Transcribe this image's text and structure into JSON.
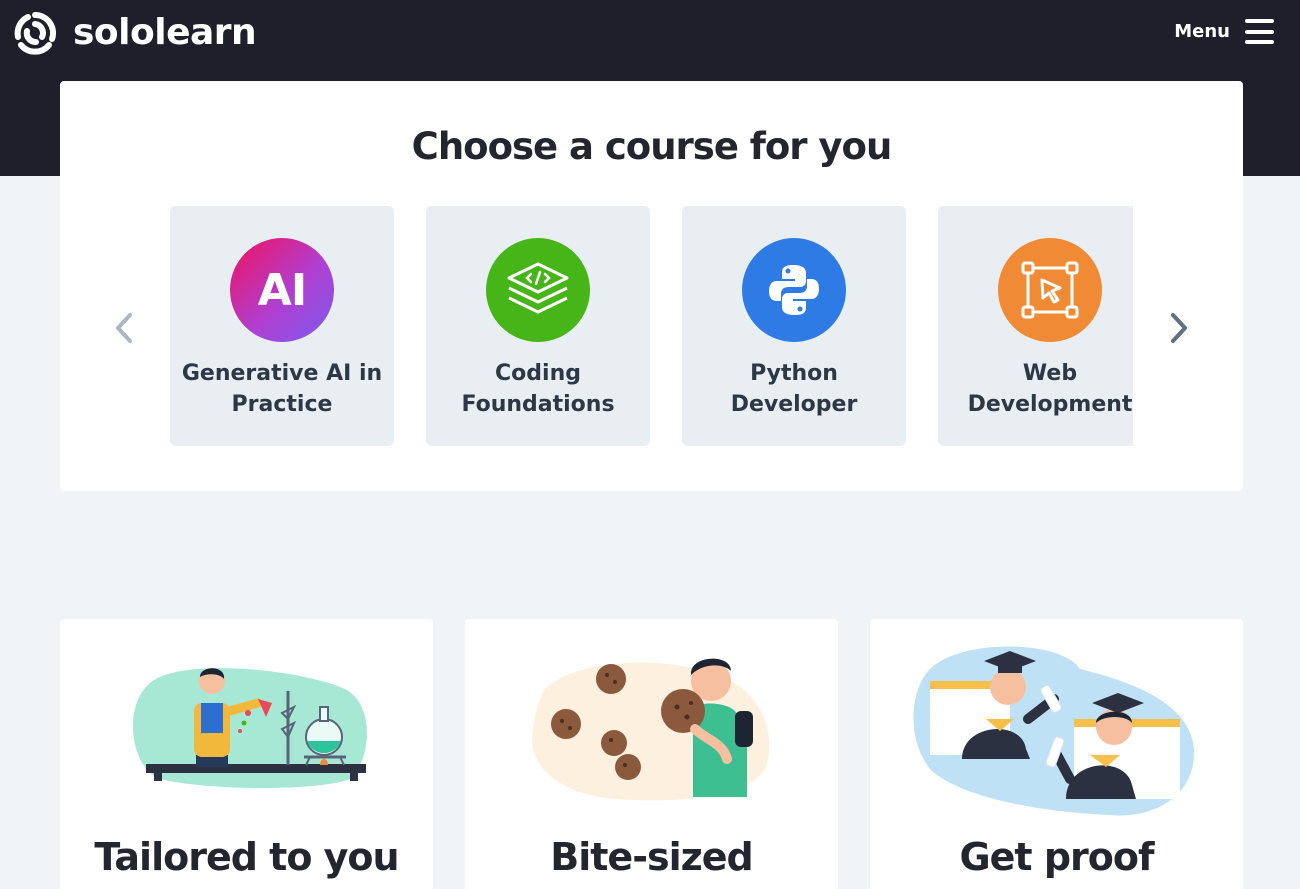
{
  "brand": {
    "name": "sololearn"
  },
  "header": {
    "menu_label": "Menu"
  },
  "courses_section": {
    "title": "Choose a course for you",
    "courses": [
      {
        "name": "Generative AI in Practice",
        "icon": "ai-icon",
        "icon_text": "AI",
        "color": "#e0196c"
      },
      {
        "name": "Coding Foundations",
        "icon": "code-stack-icon",
        "color": "#46b518"
      },
      {
        "name": "Python Developer",
        "icon": "python-icon",
        "color": "#2f7be5"
      },
      {
        "name": "Web Development",
        "icon": "cursor-select-icon",
        "color": "#f08a35"
      }
    ]
  },
  "features": [
    {
      "title": "Tailored to you",
      "illustration": "scientist-lab-illustration"
    },
    {
      "title": "Bite-sized",
      "illustration": "cookie-eating-illustration"
    },
    {
      "title": "Get proof",
      "illustration": "graduates-illustration"
    }
  ]
}
